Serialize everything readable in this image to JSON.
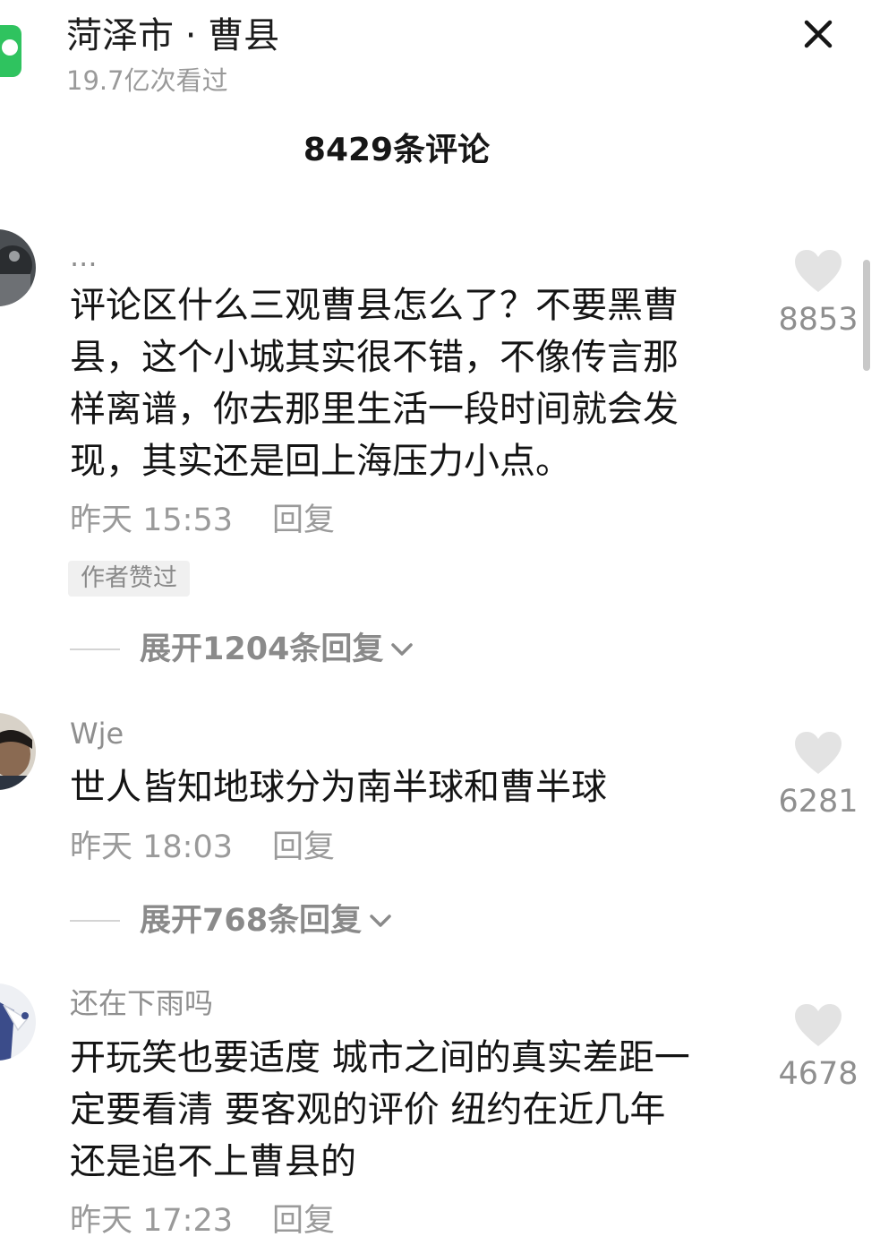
{
  "header": {
    "title": "菏泽市 · 曹县",
    "views": "19.7亿次看过",
    "comments_count": "8429条评论"
  },
  "comments": [
    {
      "username": "...",
      "text_lines": [
        "评论区什么三观曹县怎么了？不要黑曹",
        "县，这个小城其实很不错，不像传言那",
        "样离谱，你去那里生活一段时间就会发",
        "现，其实还是回上海压力小点。"
      ],
      "time": "昨天 15:53",
      "reply": "回复",
      "badge": "作者赞过",
      "expand": "展开1204条回复",
      "likes": "8853"
    },
    {
      "username": "Wje",
      "text_lines": [
        "世人皆知地球分为南半球和曹半球"
      ],
      "time": "昨天 18:03",
      "reply": "回复",
      "expand": "展开768条回复",
      "likes": "6281"
    },
    {
      "username": "还在下雨吗",
      "text_lines": [
        "开玩笑也要适度 城市之间的真实差距一",
        "定要看清 要客观的评价 纽约在近几年",
        "还是追不上曹县的"
      ],
      "time": "昨天 17:23",
      "reply": "回复",
      "likes": "4678"
    }
  ],
  "colors": {
    "topic_icon": "#2fc35f",
    "heart": "#e3e3e3",
    "secondary_text": "#9a9a9a"
  },
  "icons": {
    "close": "close-icon",
    "heart": "heart-icon",
    "chevron": "chevron-down-icon"
  }
}
